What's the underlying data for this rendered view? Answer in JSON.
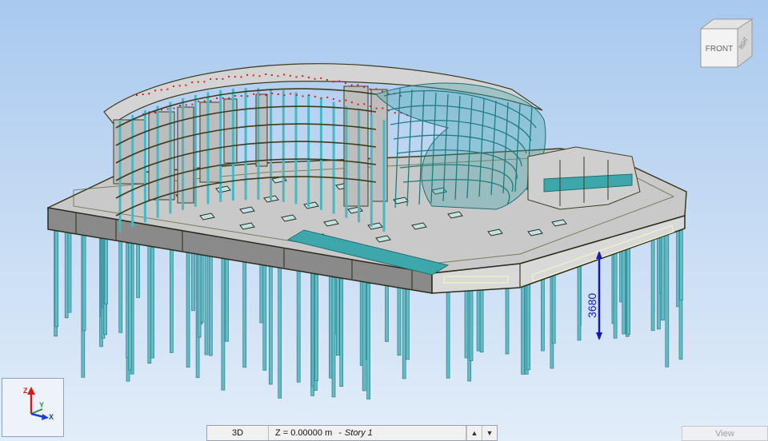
{
  "viewcube": {
    "front_label": "FRONT",
    "right_label": "RIGHT"
  },
  "dimension": {
    "label": "3680"
  },
  "axis": {
    "z_label": "Z",
    "y_label": "Y",
    "x_label": "X"
  },
  "statusbar": {
    "view_mode": "3D",
    "elevation": "Z = 0.00000 m",
    "separator": "-",
    "story": "Story 1",
    "up_arrow": "▲",
    "down_arrow": "▼",
    "view_button": "View"
  },
  "colors": {
    "slab_fill": "#c9c9c9",
    "slab_edge": "#3d3c1e",
    "beam_outline": "#eef2c4",
    "column_cyan": "#49b8c2",
    "pile_cyan": "#62bcc6",
    "steel_teal": "#3ea7ab",
    "dimension_blue": "#1418b8",
    "marker_red": "#e01818"
  }
}
